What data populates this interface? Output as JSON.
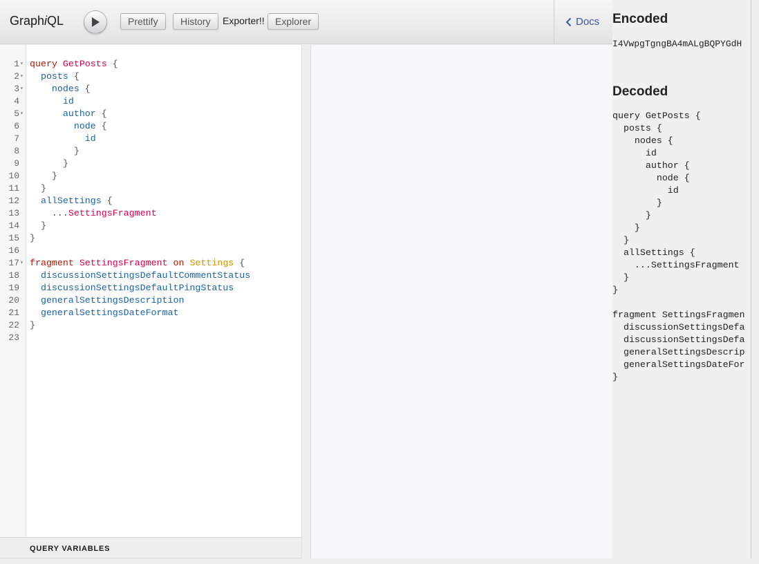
{
  "toolbar": {
    "title_prefix": "Graph",
    "title_i": "i",
    "title_suffix": "QL",
    "prettify": "Prettify",
    "history": "History",
    "exporter": "Exporter!!",
    "explorer": "Explorer",
    "docs": "Docs"
  },
  "editor": {
    "lines": [
      {
        "n": "1",
        "fold": true,
        "tokens": [
          {
            "t": "query",
            "c": "kw"
          },
          {
            "t": " "
          },
          {
            "t": "GetPosts",
            "c": "def"
          },
          {
            "t": " {",
            "c": "pun"
          }
        ]
      },
      {
        "n": "2",
        "fold": true,
        "tokens": [
          {
            "t": "  "
          },
          {
            "t": "posts",
            "c": "prop"
          },
          {
            "t": " {",
            "c": "pun"
          }
        ]
      },
      {
        "n": "3",
        "fold": true,
        "tokens": [
          {
            "t": "    "
          },
          {
            "t": "nodes",
            "c": "prop"
          },
          {
            "t": " {",
            "c": "pun"
          }
        ]
      },
      {
        "n": "4",
        "fold": false,
        "tokens": [
          {
            "t": "      "
          },
          {
            "t": "id",
            "c": "prop"
          }
        ]
      },
      {
        "n": "5",
        "fold": true,
        "tokens": [
          {
            "t": "      "
          },
          {
            "t": "author",
            "c": "prop"
          },
          {
            "t": " {",
            "c": "pun"
          }
        ]
      },
      {
        "n": "6",
        "fold": false,
        "tokens": [
          {
            "t": "        "
          },
          {
            "t": "node",
            "c": "prop"
          },
          {
            "t": " {",
            "c": "pun"
          }
        ]
      },
      {
        "n": "7",
        "fold": false,
        "tokens": [
          {
            "t": "          "
          },
          {
            "t": "id",
            "c": "prop"
          }
        ]
      },
      {
        "n": "8",
        "fold": false,
        "tokens": [
          {
            "t": "        "
          },
          {
            "t": "}",
            "c": "pun"
          }
        ]
      },
      {
        "n": "9",
        "fold": false,
        "tokens": [
          {
            "t": "      "
          },
          {
            "t": "}",
            "c": "pun"
          }
        ]
      },
      {
        "n": "10",
        "fold": false,
        "tokens": [
          {
            "t": "    "
          },
          {
            "t": "}",
            "c": "pun"
          }
        ]
      },
      {
        "n": "11",
        "fold": false,
        "tokens": [
          {
            "t": "  "
          },
          {
            "t": "}",
            "c": "pun"
          }
        ]
      },
      {
        "n": "12",
        "fold": false,
        "tokens": [
          {
            "t": "  "
          },
          {
            "t": "allSettings",
            "c": "prop"
          },
          {
            "t": " {",
            "c": "pun"
          }
        ]
      },
      {
        "n": "13",
        "fold": false,
        "tokens": [
          {
            "t": "    "
          },
          {
            "t": "...",
            "c": "pun"
          },
          {
            "t": "SettingsFragment",
            "c": "def"
          }
        ]
      },
      {
        "n": "14",
        "fold": false,
        "tokens": [
          {
            "t": "  "
          },
          {
            "t": "}",
            "c": "pun"
          }
        ]
      },
      {
        "n": "15",
        "fold": false,
        "tokens": [
          {
            "t": "}",
            "c": "pun"
          }
        ]
      },
      {
        "n": "16",
        "fold": false,
        "tokens": []
      },
      {
        "n": "17",
        "fold": true,
        "tokens": [
          {
            "t": "fragment",
            "c": "kw"
          },
          {
            "t": " "
          },
          {
            "t": "SettingsFragment",
            "c": "def"
          },
          {
            "t": " "
          },
          {
            "t": "on",
            "c": "kw"
          },
          {
            "t": " "
          },
          {
            "t": "Settings",
            "c": "typ"
          },
          {
            "t": " {",
            "c": "pun"
          }
        ]
      },
      {
        "n": "18",
        "fold": false,
        "tokens": [
          {
            "t": "  "
          },
          {
            "t": "discussionSettingsDefaultCommentStatus",
            "c": "prop"
          }
        ]
      },
      {
        "n": "19",
        "fold": false,
        "tokens": [
          {
            "t": "  "
          },
          {
            "t": "discussionSettingsDefaultPingStatus",
            "c": "prop"
          }
        ]
      },
      {
        "n": "20",
        "fold": false,
        "tokens": [
          {
            "t": "  "
          },
          {
            "t": "generalSettingsDescription",
            "c": "prop"
          }
        ]
      },
      {
        "n": "21",
        "fold": false,
        "tokens": [
          {
            "t": "  "
          },
          {
            "t": "generalSettingsDateFormat",
            "c": "prop"
          }
        ]
      },
      {
        "n": "22",
        "fold": false,
        "tokens": [
          {
            "t": "}",
            "c": "pun"
          }
        ]
      },
      {
        "n": "23",
        "fold": false,
        "tokens": []
      }
    ],
    "query_variables_label": "QUERY VARIABLES"
  },
  "panel": {
    "encoded_heading": "Encoded",
    "encoded_value": "I4VwpgTgngBA4mALgBQPYGdH",
    "decoded_heading": "Decoded",
    "decoded_lines": [
      "query GetPosts {",
      "  posts {",
      "    nodes {",
      "      id",
      "      author {",
      "        node {",
      "          id",
      "        }",
      "      }",
      "    }",
      "  }",
      "  allSettings {",
      "    ...SettingsFragment",
      "  }",
      "}",
      "",
      "fragment SettingsFragmen",
      "  discussionSettingsDefa",
      "  discussionSettingsDefa",
      "  generalSettingsDescrip",
      "  generalSettingsDateFor",
      "}"
    ]
  }
}
